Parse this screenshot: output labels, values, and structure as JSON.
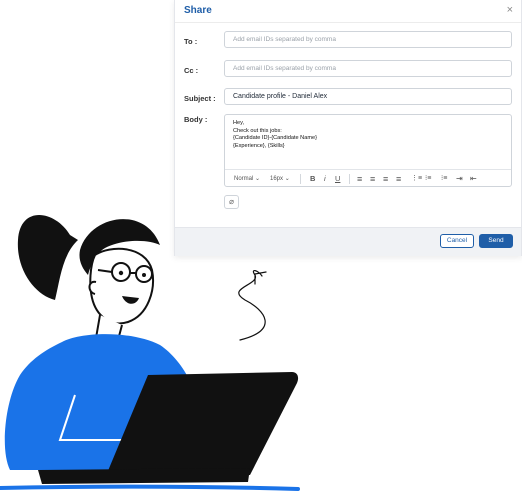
{
  "dialog": {
    "title": "Share",
    "close_glyph": "×",
    "to": {
      "label": "To :",
      "placeholder": "Add email IDs separated by comma"
    },
    "cc": {
      "label": "Cc :",
      "placeholder": "Add email IDs separated by comma"
    },
    "subject": {
      "label": "Subject :",
      "value": "Candidate profile - Daniel Alex"
    },
    "body": {
      "label": "Body :",
      "lines": [
        "Hey,",
        "Check out this jobs:",
        "{Candidate ID}-{Candidate Name}",
        "{Experience}, {Skills}"
      ]
    },
    "toolbar": {
      "paragraph_style": "Normal",
      "font_size": "16px",
      "bold": "B",
      "italic": "i",
      "underline": "U",
      "align_left": "≡",
      "align_center": "≡",
      "align_right": "≡",
      "justify": "≡",
      "ordered_list": "⋮≡",
      "bullet_list": "⁝≡",
      "indent_list": "⁝≡",
      "indent": "⇥",
      "outdent": "⇤"
    },
    "attach_icon": "⌀",
    "cancel_label": "Cancel",
    "send_label": "Send"
  },
  "colors": {
    "accent": "#1f5ea8",
    "illustration_blue": "#1a73e8",
    "illustration_dark": "#111111"
  },
  "icons": [
    "close-icon",
    "chevron-down-icon",
    "attachment-icon",
    "bold-icon",
    "italic-icon",
    "underline-icon"
  ]
}
